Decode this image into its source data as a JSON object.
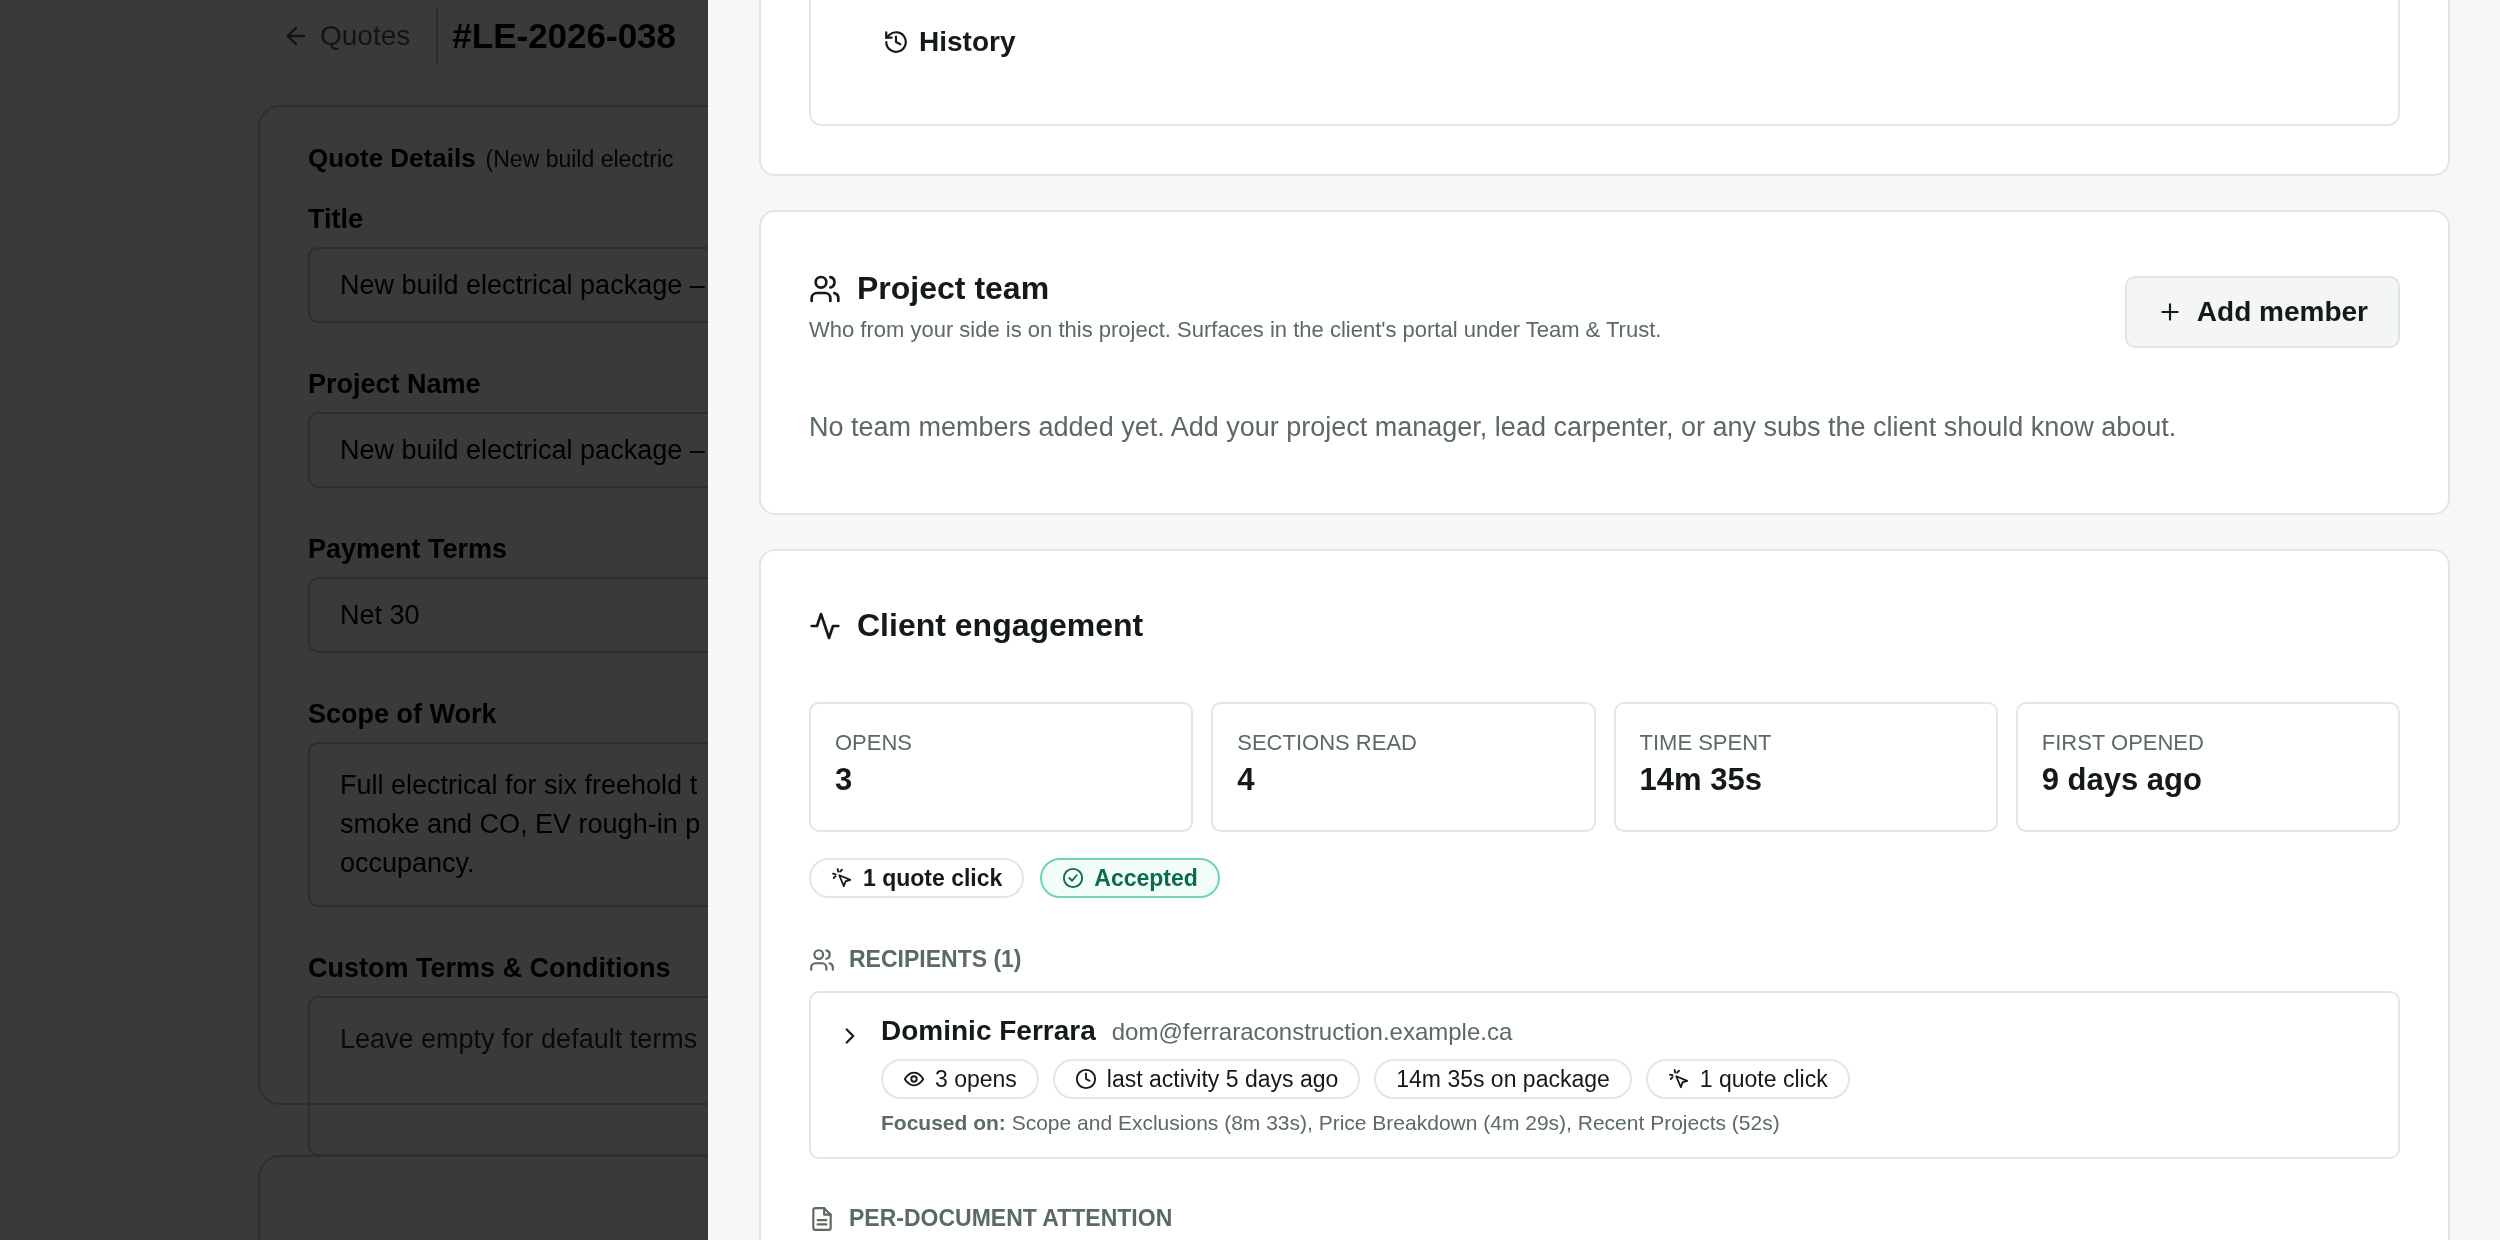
{
  "background_page": {
    "back_link": "Quotes",
    "quote_number": "#LE-2026-038",
    "section_title": "Quote Details",
    "section_subtitle": "(New build electric",
    "fields": [
      {
        "label": "Title",
        "kind": "input",
        "value": "New build electrical package –"
      },
      {
        "label": "Project Name",
        "kind": "input",
        "value": "New build electrical package –"
      },
      {
        "label": "Payment Terms",
        "kind": "input",
        "value": "Net 30"
      },
      {
        "label": "Scope of Work",
        "kind": "textarea",
        "value": "Full electrical for six freehold t\nsmoke and CO, EV rough-in p\noccupancy."
      },
      {
        "label": "Custom Terms & Conditions",
        "kind": "textarea",
        "placeholder": "Leave empty for default terms"
      }
    ]
  },
  "history_button": "History",
  "project_team": {
    "title": "Project team",
    "description": "Who from your side is on this project. Surfaces in the client's portal under Team & Trust.",
    "add_button": "Add member",
    "empty_message": "No team members added yet. Add your project manager, lead carpenter, or any subs the client should know about."
  },
  "engagement": {
    "title": "Client engagement",
    "stats": [
      {
        "label": "OPENS",
        "value": "3"
      },
      {
        "label": "SECTIONS READ",
        "value": "4"
      },
      {
        "label": "TIME SPENT",
        "value": "14m 35s"
      },
      {
        "label": "FIRST OPENED",
        "value": "9 days ago"
      }
    ],
    "badges": [
      {
        "kind": "clicks",
        "text": "1 quote click"
      },
      {
        "kind": "status",
        "text": "Accepted"
      }
    ],
    "recipients_heading": "RECIPIENTS (1)",
    "recipients": [
      {
        "name": "Dominic Ferrara",
        "email": "dom@ferraraconstruction.example.ca",
        "expanded": false,
        "chips": [
          {
            "kind": "opens",
            "text": "3 opens"
          },
          {
            "kind": "activity",
            "text": "last activity 5 days ago"
          },
          {
            "kind": "time",
            "text": "14m 35s on package"
          },
          {
            "kind": "clicks",
            "text": "1 quote click"
          }
        ],
        "focus": "**Focused on:** Scope and Exclusions (8m 33s), Price Breakdown (4m 29s), Recent Projects (52s)"
      }
    ],
    "documents_heading": "PER-DOCUMENT ATTENTION"
  }
}
